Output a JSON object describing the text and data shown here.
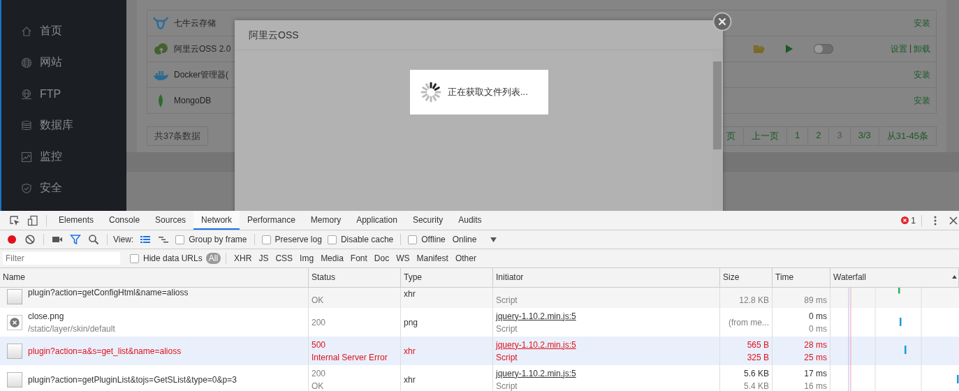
{
  "sidebar": {
    "items": [
      {
        "label": "首页"
      },
      {
        "label": "网站"
      },
      {
        "label": "FTP"
      },
      {
        "label": "数据库"
      },
      {
        "label": "监控"
      },
      {
        "label": "安全"
      }
    ]
  },
  "plugins": {
    "rows": [
      {
        "name": "七牛云存储",
        "actions": [
          "安装"
        ]
      },
      {
        "name": "阿里云OSS 2.0",
        "enabled": false,
        "actions": [
          "设置",
          "卸载"
        ],
        "separator": "|"
      },
      {
        "name": "Docker管理器(",
        "actions": [
          "安装"
        ]
      },
      {
        "name": "MongoDB",
        "actions": [
          "安装"
        ]
      }
    ],
    "total": "共37条数据",
    "pages": [
      {
        "label": "页",
        "current": false
      },
      {
        "label": "上一页",
        "current": false
      },
      {
        "label": "1",
        "current": false
      },
      {
        "label": "2",
        "current": false
      },
      {
        "label": "3",
        "current": true
      },
      {
        "label": "3/3",
        "current": false
      },
      {
        "label": "从31-45条",
        "current": false
      }
    ]
  },
  "modal": {
    "title": "阿里云OSS",
    "loading_text": "正在获取文件列表..."
  },
  "devtools": {
    "tabs": [
      {
        "label": "Elements",
        "selected": false
      },
      {
        "label": "Console",
        "selected": false
      },
      {
        "label": "Sources",
        "selected": false
      },
      {
        "label": "Network",
        "selected": true
      },
      {
        "label": "Performance",
        "selected": false
      },
      {
        "label": "Memory",
        "selected": false
      },
      {
        "label": "Application",
        "selected": false
      },
      {
        "label": "Security",
        "selected": false
      },
      {
        "label": "Audits",
        "selected": false
      }
    ],
    "error_count": "1",
    "toolbar": {
      "recording": true,
      "filter_active": true,
      "view_label": "View:",
      "large_rows": true,
      "checkboxes": [
        {
          "label": "Group by frame",
          "checked": false
        },
        {
          "label": "Preserve log",
          "checked": false
        },
        {
          "label": "Disable cache",
          "checked": false
        },
        {
          "label": "Offline",
          "checked": false
        }
      ],
      "throttling": "Online"
    },
    "filter": {
      "placeholder": "Filter",
      "hide_data_urls": {
        "label": "Hide data URLs",
        "checked": false
      },
      "types": [
        {
          "label": "All",
          "selected": true
        },
        {
          "label": "XHR",
          "selected": false
        },
        {
          "label": "JS",
          "selected": false
        },
        {
          "label": "CSS",
          "selected": false
        },
        {
          "label": "Img",
          "selected": false
        },
        {
          "label": "Media",
          "selected": false
        },
        {
          "label": "Font",
          "selected": false
        },
        {
          "label": "Doc",
          "selected": false
        },
        {
          "label": "WS",
          "selected": false
        },
        {
          "label": "Manifest",
          "selected": false
        },
        {
          "label": "Other",
          "selected": false
        }
      ]
    },
    "columns": [
      "Name",
      "Status",
      "Type",
      "Initiator",
      "Size",
      "Time",
      "Waterfall"
    ],
    "rows": [
      {
        "kind": "document",
        "error": false,
        "highlighted": false,
        "name": "plugin?action=getConfigHtml&name=alioss",
        "status_text": "OK",
        "type": "xhr",
        "initiator_type": "Script",
        "resource_size": "12.8 KB",
        "latency": "89 ms"
      },
      {
        "kind": "image",
        "error": false,
        "highlighted": false,
        "name": "close.png",
        "path": "/static/layer/skin/default",
        "status": "200",
        "type": "png",
        "initiator": "jquery-1.10.2.min.js:5",
        "initiator_type": "Script",
        "size": "(from me...",
        "time": "0 ms",
        "latency": "0 ms"
      },
      {
        "kind": "document",
        "error": true,
        "highlighted": true,
        "name": "plugin?action=a&s=get_list&name=alioss",
        "status": "500",
        "status_text": "Internal Server Error",
        "type": "xhr",
        "initiator": "jquery-1.10.2.min.js:5",
        "initiator_type": "Script",
        "size": "565 B",
        "resource_size": "325 B",
        "time": "28 ms",
        "latency": "25 ms"
      },
      {
        "kind": "document",
        "error": false,
        "highlighted": false,
        "name": "plugin?action=getPluginList&tojs=GetSList&type=0&p=3",
        "status": "200",
        "status_text": "OK",
        "type": "xhr",
        "initiator": "jquery-1.10.2.min.js:5",
        "initiator_type": "Script",
        "size": "5.6 KB",
        "resource_size": "5.4 KB",
        "time": "17 ms",
        "latency": "16 ms"
      }
    ]
  }
}
